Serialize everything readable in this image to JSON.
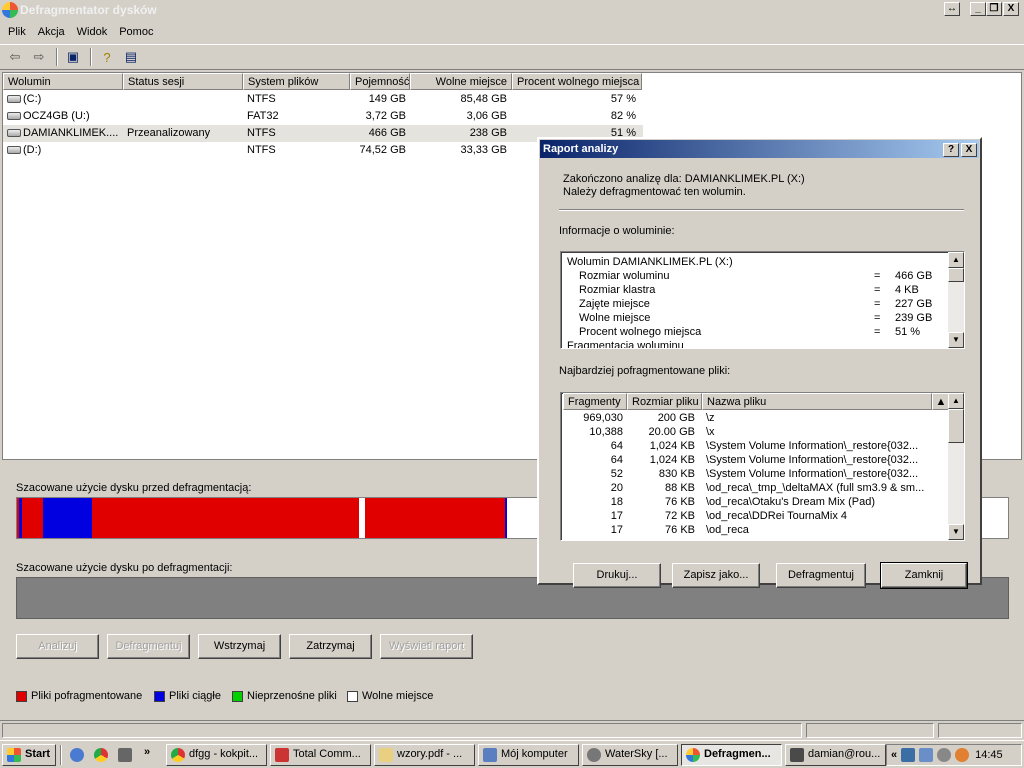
{
  "window": {
    "title": "Defragmentator dysków",
    "buttons": [
      "↔",
      "_",
      "❐",
      "X"
    ]
  },
  "menu": [
    "Plik",
    "Akcja",
    "Widok",
    "Pomoc"
  ],
  "columns": [
    "Wolumin",
    "Status sesji",
    "System plików",
    "Pojemność",
    "Wolne miejsce",
    "Procent wolnego miejsca"
  ],
  "volumes": [
    {
      "name": "(C:)",
      "status": "",
      "fs": "NTFS",
      "capacity": "149 GB",
      "free": "85,48 GB",
      "pct": "57 %"
    },
    {
      "name": "OCZ4GB (U:)",
      "status": "",
      "fs": "FAT32",
      "capacity": "3,72 GB",
      "free": "3,06 GB",
      "pct": "82 %"
    },
    {
      "name": "DAMIANKLIMEK....",
      "status": "Przeanalizowany",
      "fs": "NTFS",
      "capacity": "466 GB",
      "free": "238 GB",
      "pct": "51 %"
    },
    {
      "name": "(D:)",
      "status": "",
      "fs": "NTFS",
      "capacity": "74,52 GB",
      "free": "33,33 GB",
      "pct": ""
    }
  ],
  "lower": {
    "before_label": "Szacowane użycie dysku przed defragmentacją:",
    "after_label": "Szacowane użycie dysku po defragmentacji:",
    "buttons": {
      "analyze": "Analizuj",
      "defrag": "Defragmentuj",
      "pause": "Wstrzymaj",
      "stop": "Zatrzymaj",
      "report": "Wyświetl raport"
    },
    "legend": {
      "fragmented": "Pliki pofragmentowane",
      "contiguous": "Pliki ciągłe",
      "unmovable": "Nieprzenośne pliki",
      "free": "Wolne miejsce"
    }
  },
  "colors": {
    "fragmented": "#e00000",
    "contiguous": "#0000e0",
    "unmovable": "#00d000",
    "free": "#ffffff"
  },
  "dialog": {
    "title": "Raport analizy",
    "msg1": "Zakończono analizę dla: DAMIANKLIMEK.PL (X:)",
    "msg2": "Należy defragmentować ten wolumin.",
    "info_label": "Informacje o woluminie:",
    "info_title": "Wolumin  DAMIANKLIMEK.PL (X:)",
    "info_rows": [
      {
        "k": "Rozmiar woluminu",
        "eq": "=",
        "v": "466 GB"
      },
      {
        "k": "Rozmiar klastra",
        "eq": "=",
        "v": "4 KB"
      },
      {
        "k": "Zajęte miejsce",
        "eq": "=",
        "v": "227 GB"
      },
      {
        "k": "Wolne miejsce",
        "eq": "=",
        "v": "239 GB"
      },
      {
        "k": "Procent wolnego miejsca",
        "eq": "=",
        "v": "51 %"
      }
    ],
    "info_tail": "Fragmentacja woluminu",
    "files_label": "Najbardziej pofragmentowane pliki:",
    "file_cols": [
      "Fragmenty",
      "Rozmiar pliku",
      "Nazwa pliku"
    ],
    "files": [
      {
        "f": "969,030",
        "s": "200 GB",
        "n": "\\z"
      },
      {
        "f": "10,388",
        "s": "20.00 GB",
        "n": "\\x"
      },
      {
        "f": "64",
        "s": "1,024 KB",
        "n": "\\System Volume Information\\_restore{032..."
      },
      {
        "f": "64",
        "s": "1,024 KB",
        "n": "\\System Volume Information\\_restore{032..."
      },
      {
        "f": "52",
        "s": "830 KB",
        "n": "\\System Volume Information\\_restore{032..."
      },
      {
        "f": "20",
        "s": "88 KB",
        "n": "\\od_reca\\_tmp_\\deltaMAX (full sm3.9 & sm..."
      },
      {
        "f": "18",
        "s": "76 KB",
        "n": "\\od_reca\\Otaku's Dream Mix (Pad)"
      },
      {
        "f": "17",
        "s": "72 KB",
        "n": "\\od_reca\\DDRei TournaMix 4"
      },
      {
        "f": "17",
        "s": "76 KB",
        "n": "\\od_reca"
      }
    ],
    "buttons": {
      "print": "Drukuj...",
      "save": "Zapisz jako...",
      "defrag": "Defragmentuj",
      "close": "Zamknij"
    }
  },
  "taskbar": {
    "start": "Start",
    "chevron": "»",
    "items": [
      "dfgg - kokpit...",
      "Total Comm...",
      "wzory.pdf - ...",
      "Mój komputer",
      "WaterSky  [...",
      "Defragmen...",
      "damian@rou..."
    ],
    "tray_chevron": "«",
    "clock": "14:45"
  }
}
